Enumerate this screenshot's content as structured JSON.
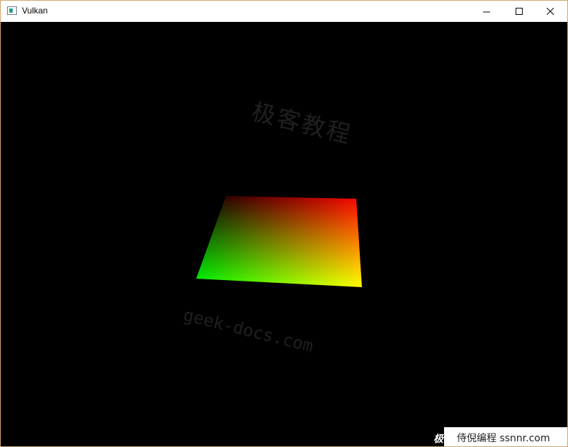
{
  "window": {
    "title": "Vulkan",
    "icon": "app-window-icon",
    "controls": {
      "minimize_icon": "minimize-icon",
      "maximize_icon": "maximize-icon",
      "close_icon": "close-icon"
    }
  },
  "viewport": {
    "background": "#000000",
    "quad_colors": {
      "top_left": "#000000",
      "top_right": "#ff0000",
      "bottom_right": "#ffff00",
      "bottom_left": "#00ff00"
    }
  },
  "watermarks": {
    "chinese": "极客教程",
    "url": "geek-docs.com",
    "badge": "侍倪编程 ssnnr.com",
    "badge_logo": "极"
  }
}
